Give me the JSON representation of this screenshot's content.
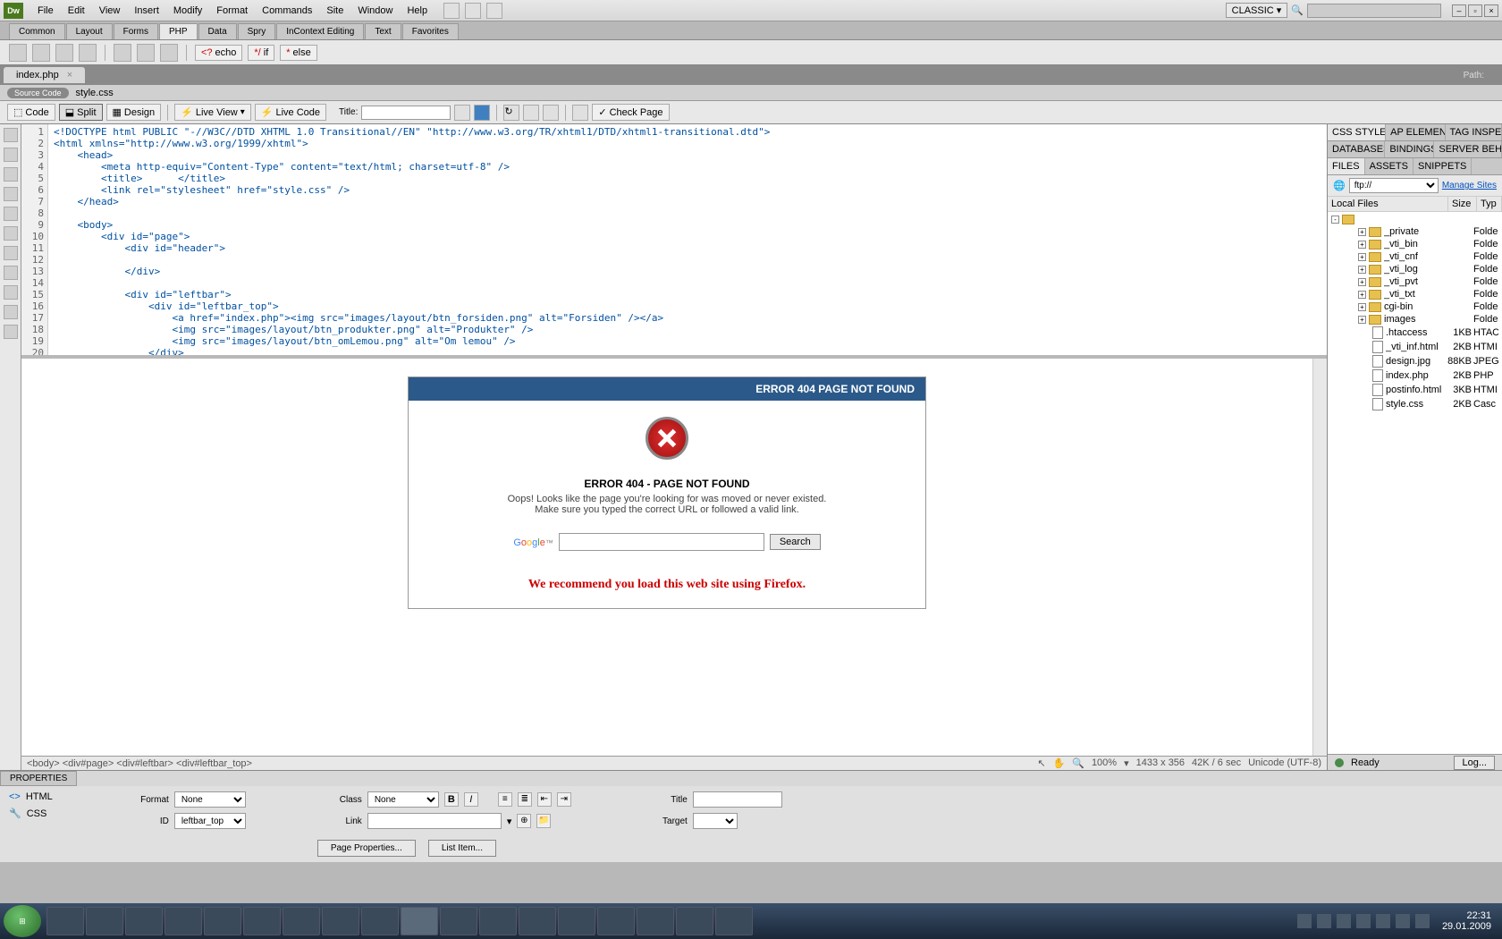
{
  "menubar": {
    "logo": "Dw",
    "items": [
      "File",
      "Edit",
      "View",
      "Insert",
      "Modify",
      "Format",
      "Commands",
      "Site",
      "Window",
      "Help"
    ],
    "layout": "CLASSIC"
  },
  "category_tabs": [
    "Common",
    "Layout",
    "Forms",
    "PHP",
    "Data",
    "Spry",
    "InContext Editing",
    "Text",
    "Favorites"
  ],
  "active_category": "PHP",
  "insert_chips": [
    "echo",
    "if",
    "else"
  ],
  "doc_tab": "index.php",
  "path_label": "Path:",
  "related": {
    "source": "Source Code",
    "style": "style.css"
  },
  "toolbar": {
    "code": "Code",
    "split": "Split",
    "design": "Design",
    "liveview": "Live View",
    "livecode": "Live Code",
    "title_label": "Title:",
    "checkpage": "Check Page"
  },
  "code_lines": [
    "<!DOCTYPE html PUBLIC \"-//W3C//DTD XHTML 1.0 Transitional//EN\" \"http://www.w3.org/TR/xhtml1/DTD/xhtml1-transitional.dtd\">",
    "<html xmlns=\"http://www.w3.org/1999/xhtml\">",
    "    <head>",
    "        <meta http-equiv=\"Content-Type\" content=\"text/html; charset=utf-8\" />",
    "        <title>      </title>",
    "        <link rel=\"stylesheet\" href=\"style.css\" />",
    "    </head>",
    "",
    "    <body>",
    "        <div id=\"page\">",
    "            <div id=\"header\">",
    "",
    "            </div>",
    "",
    "            <div id=\"leftbar\">",
    "                <div id=\"leftbar_top\">",
    "                    <a href=\"index.php\"><img src=\"images/layout/btn_forsiden.png\" alt=\"Forsiden\" /></a>",
    "                    <img src=\"images/layout/btn_produkter.png\" alt=\"Produkter\" />",
    "                    <img src=\"images/layout/btn_omLemou.png\" alt=\"Om lemou\" />",
    "                </div>"
  ],
  "preview": {
    "header": "ERROR 404 PAGE NOT FOUND",
    "title": "ERROR 404 - PAGE NOT FOUND",
    "line1": "Oops! Looks like the page you're looking for was moved or never existed.",
    "line2": "Make sure you typed the correct URL or followed a valid link.",
    "search_btn": "Search",
    "firefox": "We recommend you load this web site using Firefox."
  },
  "breadcrumb": {
    "path": "<body>  <div#page>  <div#leftbar>  <div#leftbar_top>",
    "zoom": "100%",
    "dims": "1433 x 356",
    "size": "42K / 6 sec",
    "enc": "Unicode (UTF-8)"
  },
  "panels": {
    "css_tabs": [
      "CSS STYLES",
      "AP ELEMENT",
      "TAG INSPEC"
    ],
    "db_tabs": [
      "DATABASES",
      "BINDINGS",
      "SERVER BEHA"
    ],
    "file_tabs": [
      "FILES",
      "ASSETS",
      "SNIPPETS"
    ],
    "ftp_label": "ftp://",
    "manage": "Manage Sites",
    "col_local": "Local Files",
    "col_size": "Size",
    "col_type": "Typ",
    "folders": [
      {
        "name": "_private",
        "size": "",
        "type": "Folde"
      },
      {
        "name": "_vti_bin",
        "size": "",
        "type": "Folde"
      },
      {
        "name": "_vti_cnf",
        "size": "",
        "type": "Folde"
      },
      {
        "name": "_vti_log",
        "size": "",
        "type": "Folde"
      },
      {
        "name": "_vti_pvt",
        "size": "",
        "type": "Folde"
      },
      {
        "name": "_vti_txt",
        "size": "",
        "type": "Folde"
      },
      {
        "name": "cgi-bin",
        "size": "",
        "type": "Folde"
      },
      {
        "name": "images",
        "size": "",
        "type": "Folde"
      }
    ],
    "files": [
      {
        "name": ".htaccess",
        "size": "1KB",
        "type": "HTAC"
      },
      {
        "name": "_vti_inf.html",
        "size": "2KB",
        "type": "HTMI"
      },
      {
        "name": "design.jpg",
        "size": "88KB",
        "type": "JPEG"
      },
      {
        "name": "index.php",
        "size": "2KB",
        "type": "PHP"
      },
      {
        "name": "postinfo.html",
        "size": "3KB",
        "type": "HTMI"
      },
      {
        "name": "style.css",
        "size": "2KB",
        "type": "Casc"
      }
    ],
    "ready": "Ready",
    "log": "Log..."
  },
  "properties": {
    "tab": "PROPERTIES",
    "html": "HTML",
    "css": "CSS",
    "format_label": "Format",
    "format_val": "None",
    "id_label": "ID",
    "id_val": "leftbar_top",
    "class_label": "Class",
    "class_val": "None",
    "link_label": "Link",
    "title_label": "Title",
    "target_label": "Target",
    "page_props": "Page Properties...",
    "list_item": "List Item..."
  },
  "taskbar": {
    "time": "22:31",
    "date": "29.01.2009"
  }
}
